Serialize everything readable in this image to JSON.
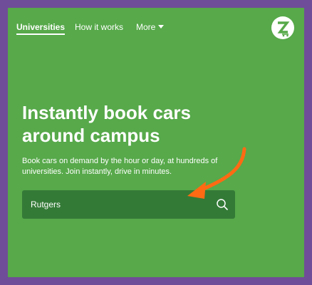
{
  "colors": {
    "outer_border": "#6f4d98",
    "brand_green": "#57a94a",
    "search_bg": "#347a37",
    "annotation_arrow": "#ff6a13",
    "text": "#ffffff"
  },
  "nav": {
    "items": [
      {
        "label": "Universities",
        "active": true
      },
      {
        "label": "How it works",
        "active": false
      },
      {
        "label": "More",
        "active": false,
        "has_dropdown": true
      }
    ],
    "logo_icon": "zipcar-logo-icon"
  },
  "hero": {
    "title": "Instantly book cars around campus",
    "subtitle": "Book cars on demand by the hour or day, at hundreds of universities. Join instantly, drive in minutes."
  },
  "search": {
    "value": "Rutgers",
    "icon": "search-icon"
  },
  "annotation": {
    "icon": "orange-arrow-icon"
  }
}
